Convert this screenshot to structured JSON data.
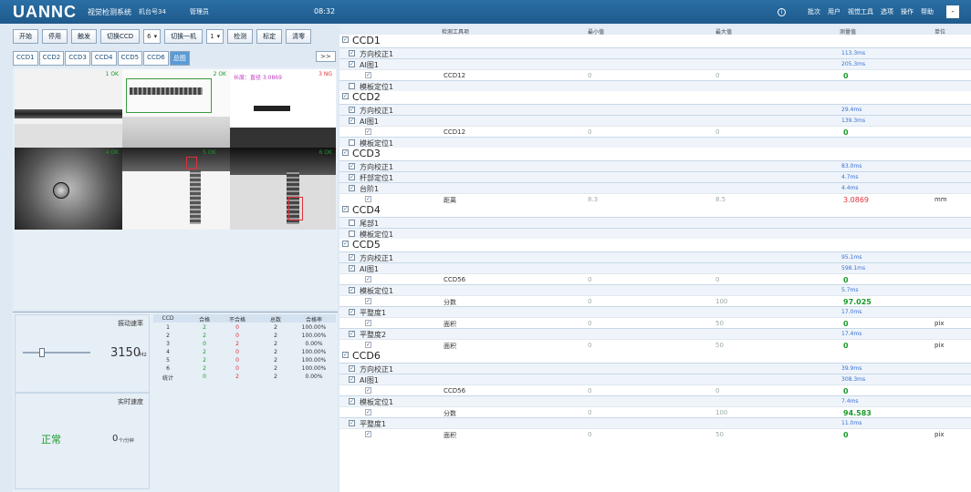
{
  "app": {
    "logo": "UANNC",
    "system_name": "视觉检测系统",
    "station": "机台号34",
    "user": "管理员",
    "clock": "08:32"
  },
  "menu": [
    "批次",
    "用户",
    "视觉工具",
    "选项",
    "操作",
    "帮助"
  ],
  "window_button": "-",
  "toolbar": {
    "start": "开始",
    "stop": "停用",
    "trigger": "触发",
    "ccd_select": {
      "label": "切换CCD",
      "value": "6"
    },
    "mode_select": {
      "label": "切换一机",
      "value": "1"
    },
    "check": "检测",
    "calibrate": "标定",
    "reset": "清零"
  },
  "tabs": [
    "CCD1",
    "CCD2",
    "CCD3",
    "CCD4",
    "CCD5",
    "CCD6",
    "总图"
  ],
  "expand": ">>",
  "cams": {
    "c1_label": "1 OK",
    "c2_label": "2 OK",
    "c3_label": "长度：直径 3.0869",
    "c3_tag": "3 NG",
    "c4_label": "4 OK",
    "c5_label": "5 OK",
    "c6_label": "6 OK"
  },
  "stats": {
    "speed_label": "振动速率",
    "speed_value": "3150",
    "speed_unit": "Hz",
    "realtime_label": "实时速度",
    "realtime_value": "0",
    "realtime_unit": "个/分钟",
    "status": "正常",
    "headers": [
      "CCD",
      "合格",
      "不合格",
      "总数",
      "合格率"
    ],
    "rows": [
      [
        "1",
        "2",
        "0",
        "2",
        "100.00%"
      ],
      [
        "2",
        "2",
        "0",
        "2",
        "100.00%"
      ],
      [
        "3",
        "0",
        "2",
        "2",
        "0.00%"
      ],
      [
        "4",
        "2",
        "0",
        "2",
        "100.00%"
      ],
      [
        "5",
        "2",
        "0",
        "2",
        "100.00%"
      ],
      [
        "6",
        "2",
        "0",
        "2",
        "100.00%"
      ],
      [
        "统计",
        "0",
        "2",
        "2",
        "0.00%"
      ]
    ]
  },
  "results": {
    "headers": [
      "检测工具项",
      "最小值",
      "最大值",
      "测量值",
      "单位"
    ],
    "rows": [
      {
        "kind": "grp",
        "name": "CCD1"
      },
      {
        "kind": "item",
        "name": "方向校正1",
        "value": "113.3ms"
      },
      {
        "kind": "item",
        "name": "AI图1",
        "value": "205.3ms"
      },
      {
        "kind": "det",
        "label": "CCD12",
        "min": "0",
        "max": "0",
        "value": "0",
        "vcolor": "green"
      },
      {
        "kind": "item",
        "name": "模板定位1",
        "unchecked": true,
        "value": ""
      },
      {
        "kind": "grp",
        "name": "CCD2"
      },
      {
        "kind": "item",
        "name": "方向校正1",
        "value": "29.4ms"
      },
      {
        "kind": "item",
        "name": "AI图1",
        "value": "139.3ms"
      },
      {
        "kind": "det",
        "label": "CCD12",
        "min": "0",
        "max": "0",
        "value": "0",
        "vcolor": "green"
      },
      {
        "kind": "item",
        "name": "模板定位1",
        "unchecked": true,
        "value": ""
      },
      {
        "kind": "grp",
        "name": "CCD3"
      },
      {
        "kind": "item",
        "name": "方向校正1",
        "value": "83.0ms"
      },
      {
        "kind": "item",
        "name": "杆部定位1",
        "value": "4.7ms"
      },
      {
        "kind": "item",
        "name": "台阶1",
        "value": "4.4ms"
      },
      {
        "kind": "det",
        "label": "距离",
        "min": "8.3",
        "max": "8.5",
        "value": "3.0869",
        "vcolor": "red",
        "unit": "mm"
      },
      {
        "kind": "grp",
        "name": "CCD4"
      },
      {
        "kind": "item",
        "name": "尾部1",
        "unchecked": true,
        "value": ""
      },
      {
        "kind": "item",
        "name": "模板定位1",
        "unchecked": true,
        "value": ""
      },
      {
        "kind": "grp",
        "name": "CCD5"
      },
      {
        "kind": "item",
        "name": "方向校正1",
        "value": "95.1ms"
      },
      {
        "kind": "item",
        "name": "AI图1",
        "value": "598.1ms"
      },
      {
        "kind": "det",
        "label": "CCD56",
        "min": "0",
        "max": "0",
        "value": "0",
        "vcolor": "green"
      },
      {
        "kind": "item",
        "name": "模板定位1",
        "value": "5.7ms"
      },
      {
        "kind": "det",
        "label": "分数",
        "min": "0",
        "max": "100",
        "value": "97.025",
        "vcolor": "green"
      },
      {
        "kind": "item",
        "name": "平整度1",
        "value": "17.0ms"
      },
      {
        "kind": "det",
        "label": "面积",
        "min": "0",
        "max": "50",
        "value": "0",
        "vcolor": "green",
        "unit": "pix"
      },
      {
        "kind": "item",
        "name": "平整度2",
        "value": "17.4ms"
      },
      {
        "kind": "det",
        "label": "面积",
        "min": "0",
        "max": "50",
        "value": "0",
        "vcolor": "green",
        "unit": "pix"
      },
      {
        "kind": "grp",
        "name": "CCD6"
      },
      {
        "kind": "item",
        "name": "方向校正1",
        "value": "39.9ms"
      },
      {
        "kind": "item",
        "name": "AI图1",
        "value": "308.3ms"
      },
      {
        "kind": "det",
        "label": "CCD56",
        "min": "0",
        "max": "0",
        "value": "0",
        "vcolor": "green"
      },
      {
        "kind": "item",
        "name": "模板定位1",
        "value": "7.4ms"
      },
      {
        "kind": "det",
        "label": "分数",
        "min": "0",
        "max": "100",
        "value": "94.583",
        "vcolor": "green"
      },
      {
        "kind": "item",
        "name": "平整度1",
        "value": "11.0ms"
      },
      {
        "kind": "det",
        "label": "面积",
        "min": "0",
        "max": "50",
        "value": "0",
        "vcolor": "green",
        "unit": "pix"
      }
    ]
  }
}
